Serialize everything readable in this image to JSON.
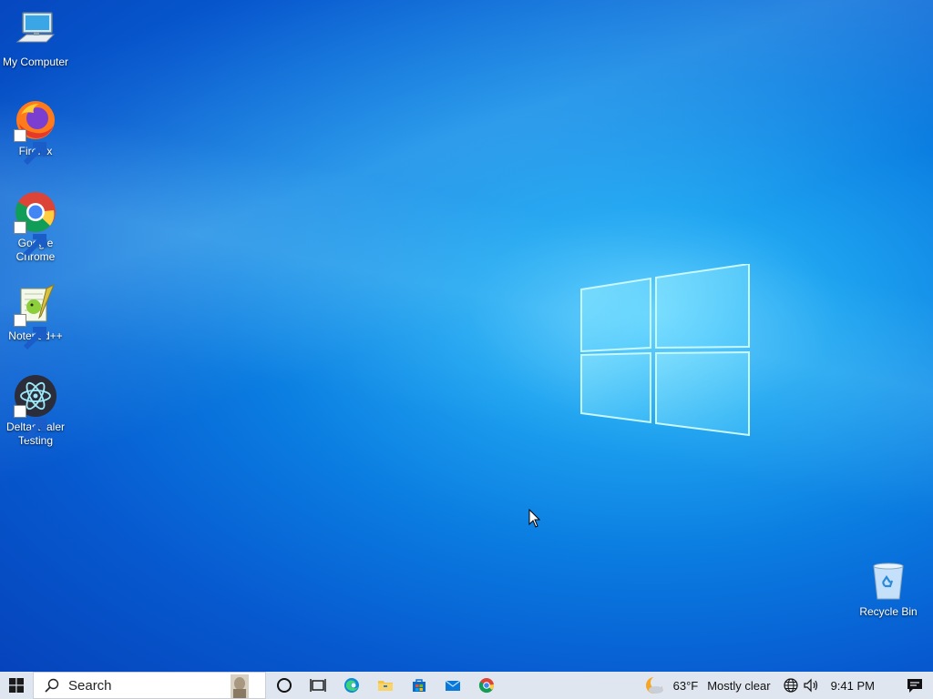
{
  "desktop": {
    "icons": [
      {
        "label": "My Computer",
        "icon": "computer-icon"
      },
      {
        "label": "Firefox",
        "icon": "firefox-icon"
      },
      {
        "label": "Google Chrome",
        "icon": "chrome-icon"
      },
      {
        "label": "Notepad++",
        "icon": "notepadpp-icon"
      },
      {
        "label": "Deltastealer Testing",
        "icon": "electron-icon"
      },
      {
        "label": "Recycle Bin",
        "icon": "recycle-bin-icon"
      }
    ]
  },
  "taskbar": {
    "search_label": "Search",
    "apps": [
      "cortana-icon",
      "task-view-icon",
      "edge-icon",
      "file-explorer-icon",
      "store-icon",
      "mail-icon",
      "chrome-icon"
    ],
    "weather": {
      "temperature": "63°F",
      "condition": "Mostly clear"
    },
    "clock": "9:41 PM"
  },
  "colors": {
    "accent": "#0078d7",
    "taskbar": "#dfe6ef"
  }
}
